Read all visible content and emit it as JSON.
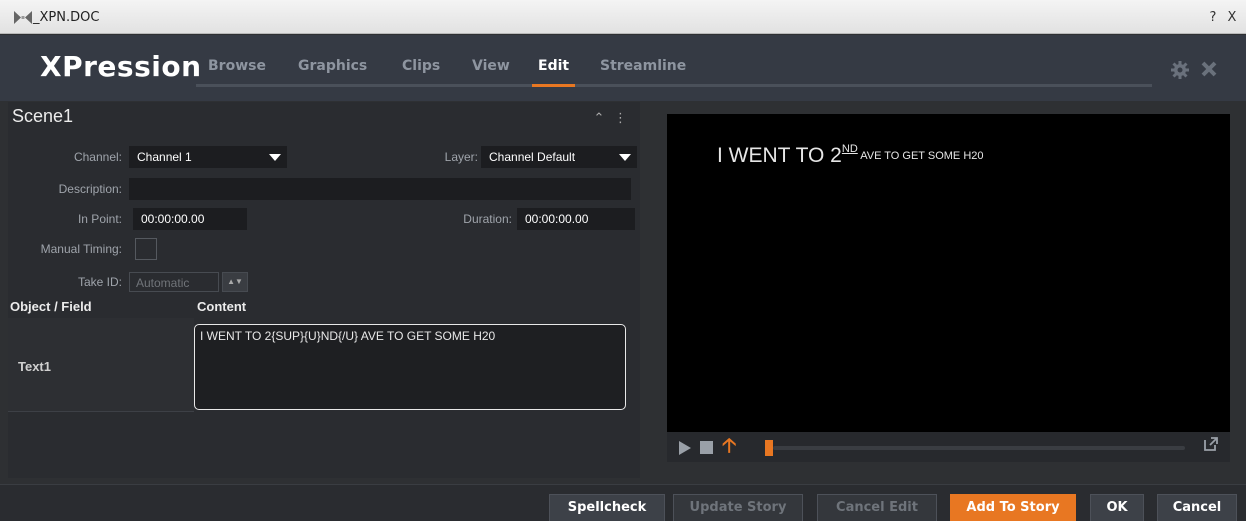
{
  "window": {
    "title": "_XPN.DOC",
    "help_label": "?",
    "close_label": "X"
  },
  "header": {
    "logo": "XPression",
    "tabs": [
      "Browse",
      "Graphics",
      "Clips",
      "View",
      "Edit",
      "Streamline"
    ],
    "active_tab": "Edit"
  },
  "scene": {
    "title": "Scene1",
    "channel_label": "Channel:",
    "channel_value": "Channel 1",
    "layer_label": "Layer:",
    "layer_value": "Channel Default",
    "description_label": "Description:",
    "description_value": "",
    "in_point_label": "In Point:",
    "in_point_value": "00:00:00.00",
    "duration_label": "Duration:",
    "duration_value": "00:00:00.00",
    "manual_timing_label": "Manual Timing:",
    "take_id_label": "Take ID:",
    "take_id_value": "Automatic"
  },
  "table": {
    "col_object": "Object / Field",
    "col_content": "Content",
    "rows": [
      {
        "object": "Text1",
        "content": "I WENT TO 2{SUP}{U}ND{/U} AVE TO GET SOME H20"
      }
    ]
  },
  "preview": {
    "text_main": "I WENT TO 2",
    "text_sup": "ND",
    "text_rest": " AVE TO GET SOME H20"
  },
  "footer": {
    "spellcheck": "Spellcheck",
    "update_story": "Update Story",
    "cancel_edit": "Cancel Edit",
    "add_to_story": "Add To Story",
    "ok": "OK",
    "cancel": "Cancel"
  },
  "colors": {
    "accent": "#e87722",
    "header_bg": "#353a44",
    "panel_bg": "#2a2c30"
  }
}
